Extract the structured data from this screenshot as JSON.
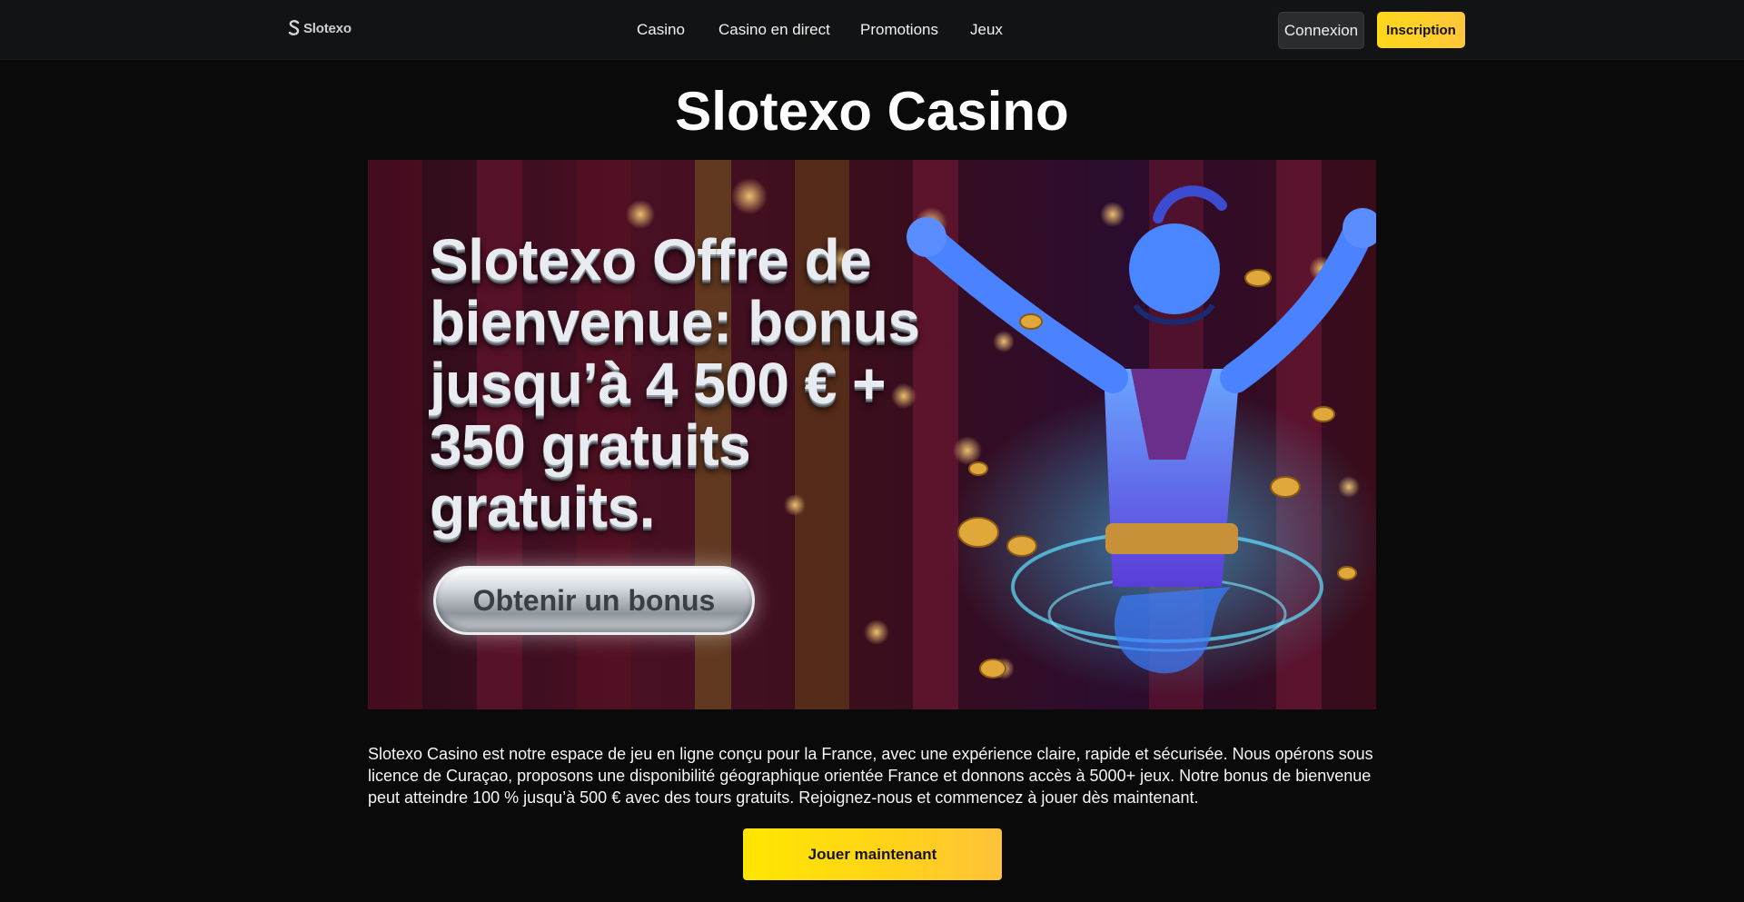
{
  "header": {
    "logo_text": "Slotexo",
    "nav": {
      "casino": "Casino",
      "live": "Casino en direct",
      "promotions": "Promotions",
      "games": "Jeux"
    },
    "login_label": "Connexion",
    "signup_label": "Inscription"
  },
  "main": {
    "title": "Slotexo Casino",
    "banner": {
      "headline": "Slotexo Offre de bienvenue: bonus jusqu’à 4 500 € + 350 gratuits gratuits.",
      "cta_label": "Obtenir un bonus",
      "illustration": "genie-character"
    },
    "intro": "Slotexo Casino est notre espace de jeu en ligne conçu pour la France, avec une expérience claire, rapide et sécurisée. Nous opérons sous licence de Curaçao, proposons une disponibilité géographique orientée France et donnons accès à 5000+ jeux. Notre bonus de bienvenue peut atteindre 100 % jusqu’à 500 € avec des tours gratuits. Rejoignez-nous et commencez à jouer dès maintenant.",
    "play_label": "Jouer maintenant"
  },
  "colors": {
    "accent": "#ffd81a",
    "background": "#0a0a0a",
    "header_bg": "#121314"
  }
}
